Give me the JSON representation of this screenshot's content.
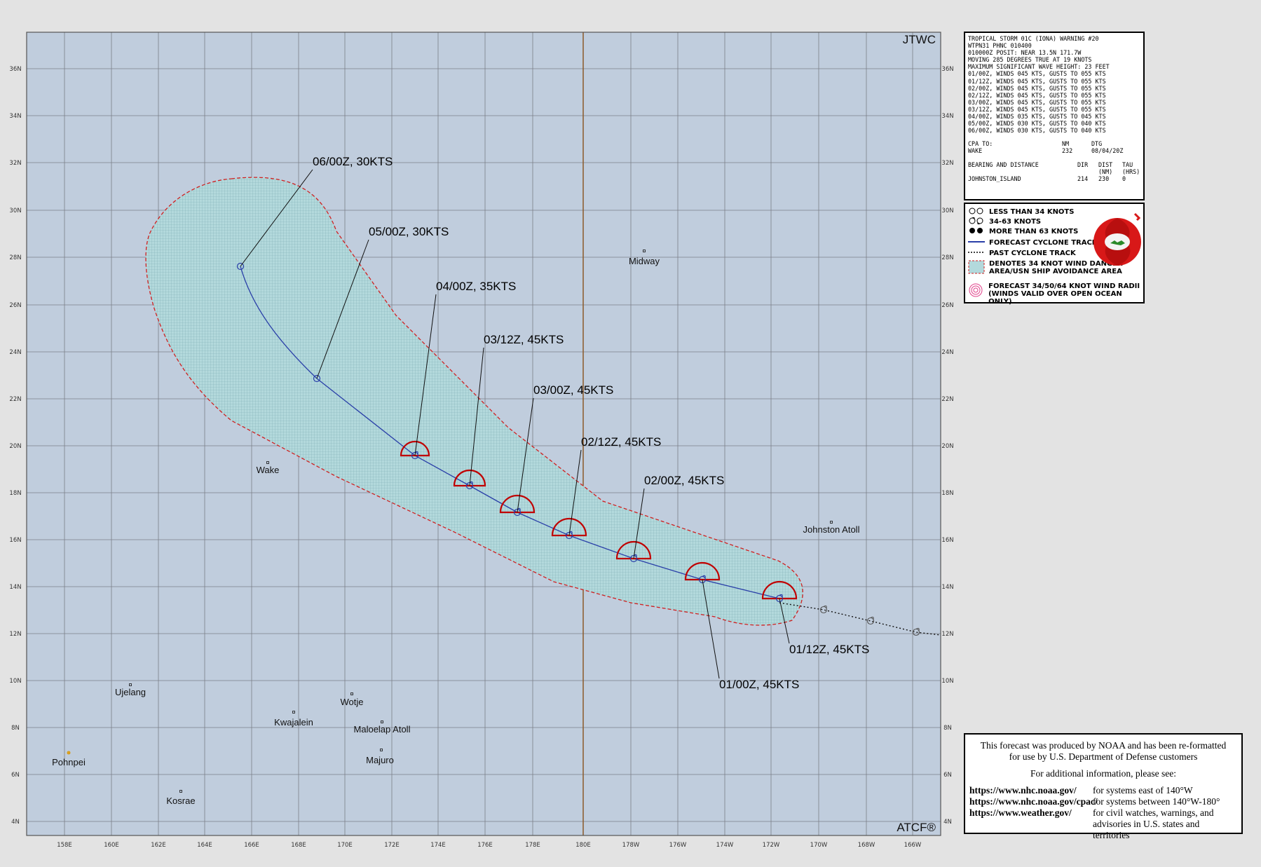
{
  "map": {
    "agency_label": "JTWC",
    "producer_label": "ATCF®",
    "lon_ticks": [
      "158E",
      "160E",
      "162E",
      "164E",
      "166E",
      "168E",
      "170E",
      "172E",
      "174E",
      "176E",
      "178E",
      "180E",
      "178W",
      "176W",
      "174W",
      "172W",
      "170W",
      "168W",
      "166W"
    ],
    "lat_ticks": [
      "4N",
      "6N",
      "8N",
      "10N",
      "12N",
      "14N",
      "16N",
      "18N",
      "20N",
      "22N",
      "24N",
      "26N",
      "28N",
      "30N",
      "32N",
      "34N",
      "36N"
    ],
    "places": [
      {
        "name": "Midway"
      },
      {
        "name": "Wake"
      },
      {
        "name": "Johnston Atoll"
      },
      {
        "name": "Ujelang"
      },
      {
        "name": "Kwajalein"
      },
      {
        "name": "Wotje"
      },
      {
        "name": "Maloelap Atoll"
      },
      {
        "name": "Majuro"
      },
      {
        "name": "Pohnpei"
      },
      {
        "name": "Kosrae"
      }
    ],
    "forecast_labels": [
      "06/00Z,  30KTS",
      "05/00Z,  30KTS",
      "04/00Z,  35KTS",
      "03/12Z,  45KTS",
      "03/00Z,  45KTS",
      "02/12Z,  45KTS",
      "02/00Z,  45KTS",
      "01/12Z,  45KTS",
      "01/00Z,  45KTS"
    ],
    "colors": {
      "ocean": "#c0cddd",
      "grid": "#7b7f88",
      "danger_fill": "#a9d2d6",
      "danger_edge": "#d02020",
      "track": "#2a3fa8",
      "wind_radii": "#c00000",
      "dateline": "#8a5a2a"
    }
  },
  "warning": {
    "lines": [
      "TROPICAL STORM 01C (IONA) WARNING #20",
      "WTPN31 PHNC 010400",
      "010000Z POSIT: NEAR 13.5N 171.7W",
      "MOVING 285 DEGREES TRUE AT 19 KNOTS",
      "MAXIMUM SIGNIFICANT WAVE HEIGHT: 23 FEET",
      "01/00Z, WINDS 045 KTS, GUSTS TO 055 KTS",
      "01/12Z, WINDS 045 KTS, GUSTS TO 055 KTS",
      "02/00Z, WINDS 045 KTS, GUSTS TO 055 KTS",
      "02/12Z, WINDS 045 KTS, GUSTS TO 055 KTS",
      "03/00Z, WINDS 045 KTS, GUSTS TO 055 KTS",
      "03/12Z, WINDS 045 KTS, GUSTS TO 055 KTS",
      "04/00Z, WINDS 035 KTS, GUSTS TO 045 KTS",
      "05/00Z, WINDS 030 KTS, GUSTS TO 040 KTS",
      "06/00Z, WINDS 030 KTS, GUSTS TO 040 KTS"
    ],
    "cpa": {
      "header": [
        "CPA TO:",
        "NM",
        "DTG"
      ],
      "row": [
        "WAKE",
        "232",
        "08/04/20Z"
      ]
    },
    "bearing": {
      "header": [
        "BEARING AND DISTANCE",
        "DIR",
        "DIST",
        "TAU"
      ],
      "subheader": [
        "",
        "",
        "(NM)",
        "(HRS)"
      ],
      "row": [
        "JOHNSTON_ISLAND",
        "214",
        "230",
        "0"
      ]
    }
  },
  "legend": {
    "items": [
      "LESS THAN 34 KNOTS",
      "34-63 KNOTS",
      "MORE THAN 63 KNOTS",
      "FORECAST CYCLONE TRACK",
      "PAST CYCLONE TRACK",
      "DENOTES 34 KNOT WIND DANGER",
      "AREA/USN SHIP AVOIDANCE AREA",
      "FORECAST 34/50/64 KNOT WIND RADII",
      "(WINDS VALID OVER OPEN OCEAN ONLY)"
    ]
  },
  "info": {
    "line1": "This forecast was produced by NOAA and has been re-formatted",
    "line2": "for use by U.S. Department of Defense customers",
    "line3": "For additional information, please see:",
    "links": [
      {
        "url": "https://www.nhc.noaa.gov/",
        "desc": "for systems east of 140°W"
      },
      {
        "url": "https://www.nhc.noaa.gov/cpac/",
        "desc": "for systems between 140°W-180°"
      },
      {
        "url": "https://www.weather.gov/",
        "desc": "for civil watches, warnings, and"
      }
    ],
    "line_last": "advisories in U.S. states and territories"
  }
}
